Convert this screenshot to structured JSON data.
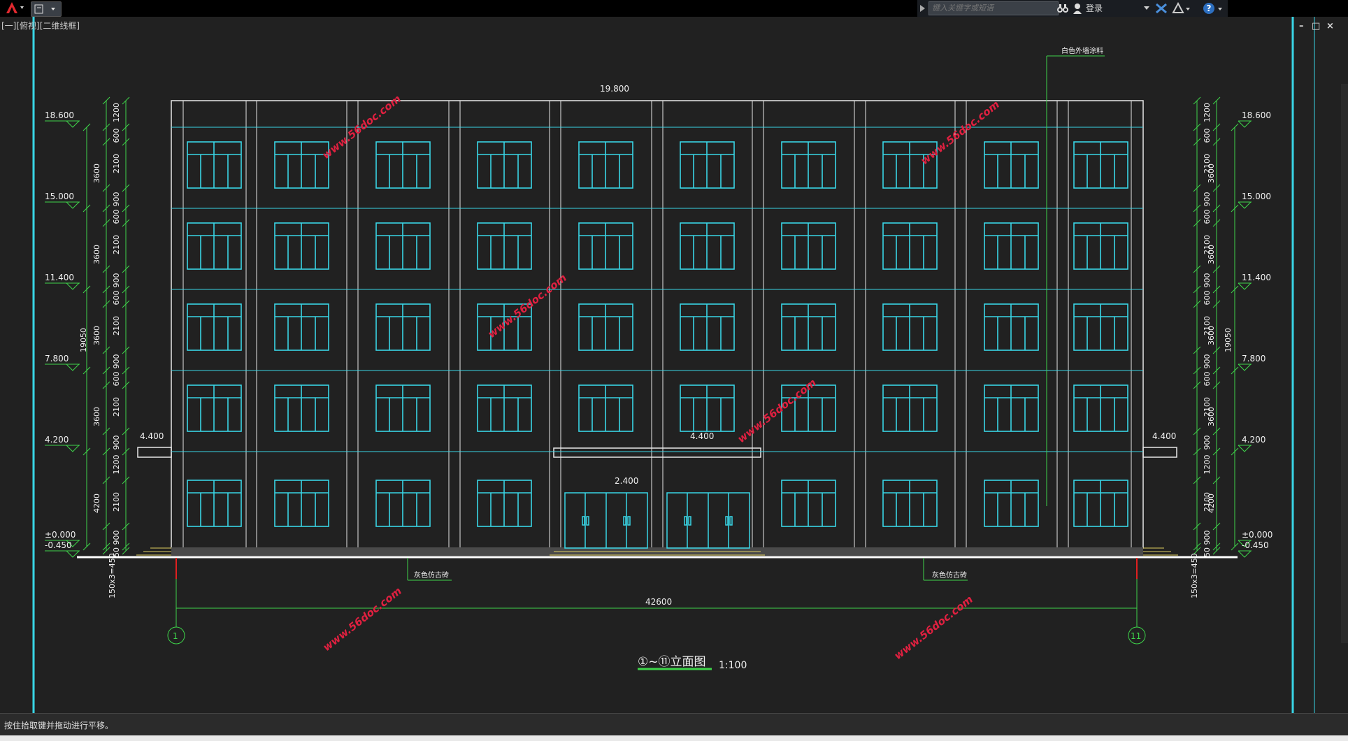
{
  "toolbar": {
    "search_placeholder": "键入关键字或短语",
    "login_label": "登录",
    "help_label": "?"
  },
  "viewport": {
    "label": "[一][俯视][二维线框]",
    "window_controls": [
      "–",
      "□",
      "×"
    ]
  },
  "drawing": {
    "title_prefix": "①~⑪立面图",
    "scale": "1:100",
    "axis_left": "1",
    "axis_right": "11",
    "overall_width": "42600",
    "top_elevation": "19.800",
    "canopy_left": "4.400",
    "canopy_center": "4.400",
    "canopy_right": "4.400",
    "door_elevation": "2.400",
    "note_paint": "白色外墙涂料",
    "note_tile_left": "灰色仿古砖",
    "note_tile_right": "灰色仿古砖",
    "total_height": "19050",
    "base_dim": "150x3=450",
    "watermark": "www.56doc.com",
    "levels": [
      "18.600",
      "15.000",
      "11.400",
      "7.800",
      "4.200",
      "±0.000",
      "-0.450"
    ],
    "floor_dims_left": [
      "3600",
      "3600",
      "3600",
      "3600",
      "4200"
    ],
    "detail_dims_top": [
      "1200",
      "600",
      "2100"
    ],
    "detail_dims_repeat": [
      "900",
      "600",
      "2100"
    ],
    "detail_dims_bottom": [
      "900",
      "1200",
      "2100",
      "900",
      "50"
    ]
  },
  "status": {
    "message": "按住拾取键并拖动进行平移。"
  }
}
